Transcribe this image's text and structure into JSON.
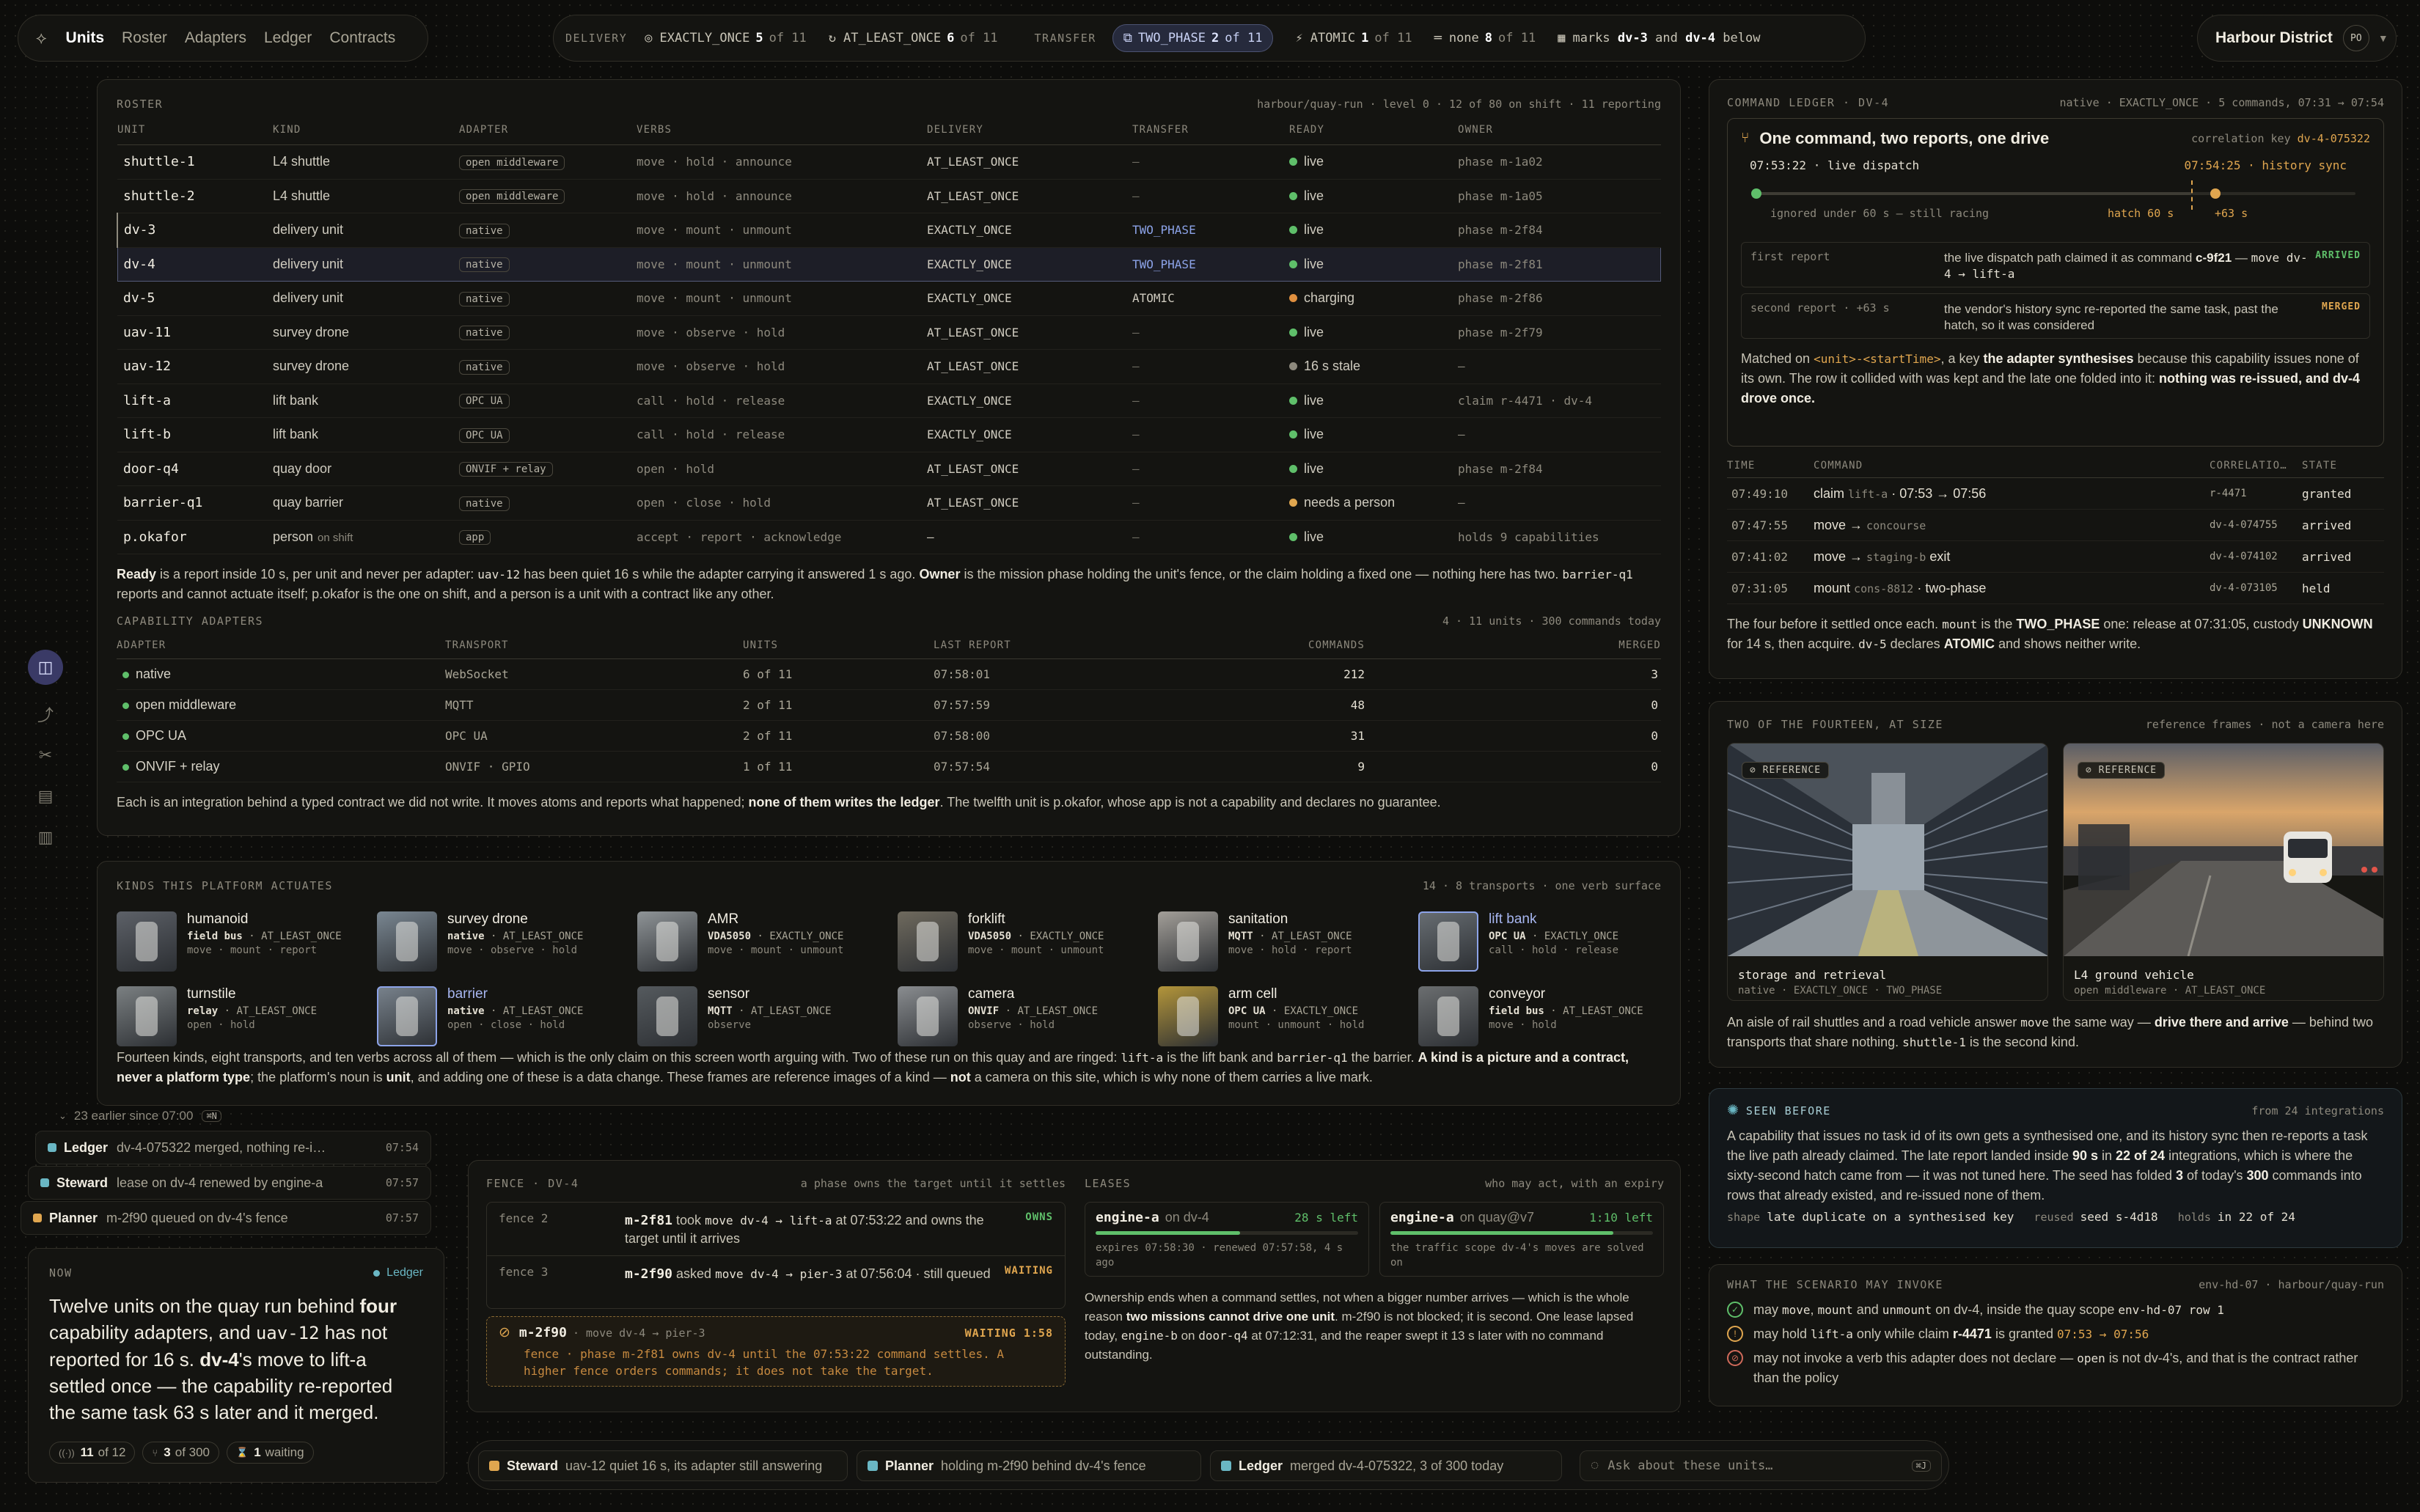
{
  "nav": {
    "items": [
      "Units",
      "Roster",
      "Adapters",
      "Ledger",
      "Contracts"
    ]
  },
  "status": {
    "delivery_label": "DELIVERY",
    "exactly_once": {
      "label": "EXACTLY_ONCE",
      "n": "5",
      "of": "of 11"
    },
    "at_least_once": {
      "label": "AT_LEAST_ONCE",
      "n": "6",
      "of": "of 11"
    },
    "transfer_label": "TRANSFER",
    "two_phase": {
      "label": "TWO_PHASE",
      "n": "2",
      "of": "of 11"
    },
    "atomic": {
      "label": "ATOMIC",
      "n": "1",
      "of": "of 11"
    },
    "none": {
      "label": "none",
      "n": "8",
      "of": "of 11"
    },
    "marks": {
      "pre": "marks",
      "a": "dv-3",
      "mid": "and",
      "b": "dv-4",
      "post": "below"
    }
  },
  "site": {
    "name": "Harbour District",
    "initials": "PO"
  },
  "roster": {
    "caption": "ROSTER",
    "meta": "harbour/quay-run · level 0 · 12 of 80 on shift · 11 reporting",
    "columns": [
      "UNIT",
      "KIND",
      "ADAPTER",
      "VERBS",
      "DELIVERY",
      "TRANSFER",
      "READY",
      "OWNER"
    ],
    "rows": [
      {
        "unit": "shuttle-1",
        "kind": "L4 shuttle",
        "adapter": "open middleware",
        "verbs": "move · hold · announce",
        "delivery": "AT_LEAST_ONCE",
        "transfer": "–",
        "ready": "live",
        "ready_color": "#5fbf6a",
        "owner": "phase m-1a02"
      },
      {
        "unit": "shuttle-2",
        "kind": "L4 shuttle",
        "adapter": "open middleware",
        "verbs": "move · hold · announce",
        "delivery": "AT_LEAST_ONCE",
        "transfer": "–",
        "ready": "live",
        "ready_color": "#5fbf6a",
        "owner": "phase m-1a05"
      },
      {
        "unit": "dv-3",
        "kind": "delivery unit",
        "adapter": "native",
        "verbs": "move · mount · unmount",
        "delivery": "EXACTLY_ONCE",
        "transfer": "TWO_PHASE",
        "ready": "live",
        "ready_color": "#5fbf6a",
        "owner": "phase m-2f84"
      },
      {
        "unit": "dv-4",
        "kind": "delivery unit",
        "adapter": "native",
        "verbs": "move · mount · unmount",
        "delivery": "EXACTLY_ONCE",
        "transfer": "TWO_PHASE",
        "ready": "live",
        "ready_color": "#5fbf6a",
        "owner": "phase m-2f81"
      },
      {
        "unit": "dv-5",
        "kind": "delivery unit",
        "adapter": "native",
        "verbs": "move · mount · unmount",
        "delivery": "EXACTLY_ONCE",
        "transfer": "ATOMIC",
        "ready": "charging",
        "ready_color": "#e0903f",
        "owner": "phase m-2f86"
      },
      {
        "unit": "uav-11",
        "kind": "survey drone",
        "adapter": "native",
        "verbs": "move · observe · hold",
        "delivery": "AT_LEAST_ONCE",
        "transfer": "–",
        "ready": "live",
        "ready_color": "#5fbf6a",
        "owner": "phase m-2f79"
      },
      {
        "unit": "uav-12",
        "kind": "survey drone",
        "adapter": "native",
        "verbs": "move · observe · hold",
        "delivery": "AT_LEAST_ONCE",
        "transfer": "–",
        "ready": "16 s stale",
        "ready_color": "#8d897d",
        "owner": "–"
      },
      {
        "unit": "lift-a",
        "kind": "lift bank",
        "adapter": "OPC UA",
        "verbs": "call · hold · release",
        "delivery": "EXACTLY_ONCE",
        "transfer": "–",
        "ready": "live",
        "ready_color": "#5fbf6a",
        "owner": "claim r-4471 · dv-4"
      },
      {
        "unit": "lift-b",
        "kind": "lift bank",
        "adapter": "OPC UA",
        "verbs": "call · hold · release",
        "delivery": "EXACTLY_ONCE",
        "transfer": "–",
        "ready": "live",
        "ready_color": "#5fbf6a",
        "owner": "–"
      },
      {
        "unit": "door-q4",
        "kind": "quay door",
        "adapter": "ONVIF + relay",
        "verbs": "open · hold",
        "delivery": "AT_LEAST_ONCE",
        "transfer": "–",
        "ready": "live",
        "ready_color": "#5fbf6a",
        "owner": "phase m-2f84"
      },
      {
        "unit": "barrier-q1",
        "kind": "quay barrier",
        "adapter": "native",
        "verbs": "open · close · hold",
        "delivery": "AT_LEAST_ONCE",
        "transfer": "–",
        "ready": "needs a person",
        "ready_color": "#e0a64f",
        "owner": "–"
      },
      {
        "unit": "p.okafor",
        "kind": "person",
        "kind_suffix": "on shift",
        "adapter": "app",
        "verbs": "accept · report · acknowledge",
        "delivery": "—",
        "transfer": "–",
        "ready": "live",
        "ready_color": "#5fbf6a",
        "owner": "holds 9 capabilities"
      }
    ],
    "note_html": "<b>Ready</b> is a report inside 10 s, per unit and never per adapter: <code>uav-12</code> has been quiet 16 s while the adapter carrying it answered 1 s ago. <b>Owner</b> is the mission phase holding the unit's fence, or the claim holding a fixed one — nothing here has two. <code>barrier-q1</code> reports and cannot actuate itself; p.okafor is the one on shift, and a person is a unit with a contract like any other."
  },
  "adapters": {
    "caption": "CAPABILITY ADAPTERS",
    "meta": "4 · 11 units · 300 commands today",
    "columns": [
      "ADAPTER",
      "TRANSPORT",
      "UNITS",
      "LAST REPORT",
      "COMMANDS",
      "MERGED"
    ],
    "rows": [
      {
        "name": "native",
        "transport": "WebSocket",
        "units": "6 of 11",
        "last": "07:58:01",
        "commands": "212",
        "merged": "3"
      },
      {
        "name": "open middleware",
        "transport": "MQTT",
        "units": "2 of 11",
        "last": "07:57:59",
        "commands": "48",
        "merged": "0"
      },
      {
        "name": "OPC UA",
        "transport": "OPC UA",
        "units": "2 of 11",
        "last": "07:58:00",
        "commands": "31",
        "merged": "0"
      },
      {
        "name": "ONVIF + relay",
        "transport": "ONVIF · GPIO",
        "units": "1 of 11",
        "last": "07:57:54",
        "commands": "9",
        "merged": "0"
      }
    ],
    "note_html": "Each is an integration behind a typed contract we did not write. It moves atoms and reports what happened; <b>none of them writes the ledger</b>. The twelfth unit is p.okafor, whose app is not a capability and declares no guarantee."
  },
  "kinds": {
    "caption": "KINDS THIS PLATFORM ACTUATES",
    "meta": "14 · 8 transports · one verb surface",
    "items": [
      {
        "name": "humanoid",
        "transport": "field bus",
        "delivery": "AT_LEAST_ONCE",
        "verbs": "move · mount · report"
      },
      {
        "name": "survey drone",
        "transport": "native",
        "delivery": "AT_LEAST_ONCE",
        "verbs": "move · observe · hold"
      },
      {
        "name": "AMR",
        "transport": "VDA5050",
        "delivery": "EXACTLY_ONCE",
        "verbs": "move · mount · unmount"
      },
      {
        "name": "forklift",
        "transport": "VDA5050",
        "delivery": "EXACTLY_ONCE",
        "verbs": "move · mount · unmount"
      },
      {
        "name": "sanitation",
        "transport": "MQTT",
        "delivery": "AT_LEAST_ONCE",
        "verbs": "move · hold · report"
      },
      {
        "name": "lift bank",
        "transport": "OPC UA",
        "delivery": "EXACTLY_ONCE",
        "verbs": "call · hold · release",
        "ringed": true
      },
      {
        "name": "turnstile",
        "transport": "relay",
        "delivery": "AT_LEAST_ONCE",
        "verbs": "open · hold"
      },
      {
        "name": "barrier",
        "transport": "native",
        "delivery": "AT_LEAST_ONCE",
        "verbs": "open · close · hold",
        "ringed": true
      },
      {
        "name": "sensor",
        "transport": "MQTT",
        "delivery": "AT_LEAST_ONCE",
        "verbs": "observe"
      },
      {
        "name": "camera",
        "transport": "ONVIF",
        "delivery": "AT_LEAST_ONCE",
        "verbs": "observe · hold"
      },
      {
        "name": "arm cell",
        "transport": "OPC UA",
        "delivery": "EXACTLY_ONCE",
        "verbs": "mount · unmount · hold"
      },
      {
        "name": "conveyor",
        "transport": "field bus",
        "delivery": "AT_LEAST_ONCE",
        "verbs": "move · hold"
      }
    ],
    "note_html": "Fourteen kinds, eight transports, and ten verbs across all of them — which is the only claim on this screen worth arguing with. Two of these run on this quay and are ringed: <code>lift-a</code> is the lift bank and <code>barrier-q1</code> the barrier. <b>A kind is a picture and a contract, never a platform type</b>; the platform's noun is <b>unit</b>, and adding one of these is a data change. These frames are reference images of a kind — <b>not</b> a camera on this site, which is why none of them carries a live mark."
  },
  "activity": {
    "earlier": "23 earlier since 07:00",
    "earlier_key": "⌘N",
    "items": [
      {
        "who": "Ledger",
        "text": "dv-4-075322 merged, nothing re-i…",
        "time": "07:54",
        "color": "#6ab7c4"
      },
      {
        "who": "Steward",
        "text": "lease on dv-4 renewed by engine-a",
        "time": "07:57",
        "color": "#6ab7c4"
      },
      {
        "who": "Planner",
        "text": "m-2f90 queued on dv-4's fence",
        "time": "07:57",
        "color": "#e0a64f"
      }
    ]
  },
  "now": {
    "caption": "NOW",
    "source": "Ledger",
    "text_html": "Twelve units on the quay run behind <b>four</b> capability adapters, and <span class='mono' style='font-size:24px'>uav-12</span> has not reported for 16 s. <b>dv-4</b>'s move to lift-a settled once — the capability re-reported the same task 63 s later and it merged.",
    "stats": [
      {
        "icon": "((·))",
        "n": "11",
        "label": "of 12"
      },
      {
        "icon": "⑂",
        "n": "3",
        "label": "of 300"
      },
      {
        "icon": "⌛",
        "n": "1",
        "label": "waiting"
      }
    ]
  },
  "fence": {
    "caption": "FENCE · DV-4",
    "meta": "a phase owns the target until it settles",
    "rows": [
      {
        "label": "fence 2",
        "who": "m-2f81",
        "text_html": "took <code>move dv-4 → lift-a</code> at 07:53:22 and owns the target until it arrives",
        "state": "OWNS",
        "state_color": "#5fbf6a"
      },
      {
        "label": "fence 3",
        "who": "m-2f90",
        "text_html": "asked <code>move dv-4 → pier-3</code> at 07:56:04 · still queued",
        "state": "WAITING",
        "state_color": "#e0a64f"
      }
    ],
    "wait": {
      "who": "m-2f90",
      "cmd": "· move dv-4 → pier-3",
      "state": "WAITING 1:58",
      "text": "fence · phase m-2f81 owns dv-4 until the 07:53:22 command settles. A higher fence orders commands; it does not take the target."
    }
  },
  "leases": {
    "caption": "LEASES",
    "meta": "who may act, with an expiry",
    "items": [
      {
        "holder": "engine-a",
        "on": "on dv-4",
        "left": "28 s left",
        "fill": 0.55,
        "sub": "expires 07:58:30 · renewed 07:57:58, 4 s ago"
      },
      {
        "holder": "engine-a",
        "on": "on quay@v7",
        "left": "1:10 left",
        "fill": 0.85,
        "sub": "the traffic scope dv-4's moves are solved on"
      }
    ],
    "note_html": "Ownership ends when a command settles, not when a bigger number arrives — which is the whole reason <b>two missions cannot drive one unit</b>. m-2f90 is not blocked; it is second. One lease lapsed today, <code>engine-b</code> on <code>door-q4</code> at 07:12:31, and the reaper swept it 13 s later with no command outstanding."
  },
  "bottom": {
    "chips": [
      {
        "who": "Steward",
        "text": "uav-12 quiet 16 s, its adapter still answering",
        "color": "#e0a64f"
      },
      {
        "who": "Planner",
        "text": "holding m-2f90 behind dv-4's fence",
        "color": "#6ab7c4"
      },
      {
        "who": "Ledger",
        "text": "merged dv-4-075322, 3 of 300 today",
        "color": "#6ab7c4"
      }
    ],
    "ask_placeholder": "Ask about these units…",
    "ask_key": "⌘J"
  },
  "ledger": {
    "caption": "COMMAND LEDGER · DV-4",
    "meta": "native · EXACTLY_ONCE · 5 commands, 07:31 → 07:54",
    "title": "One command, two reports, one drive",
    "corr_label": "correlation key",
    "corr_key": "dv-4-075322",
    "t_live": "07:53:22 · live dispatch",
    "t_sync": "07:54:25 · history sync",
    "ignored": "ignored under 60 s — still racing",
    "hatch": "hatch 60 s",
    "plus": "+63 s",
    "reports": [
      {
        "label": "first report",
        "text_html": "the live dispatch path claimed it as command <b>c-9f21</b> — <code>move dv-4 → lift-a</code>",
        "state": "ARRIVED",
        "color": "#5fbf6a"
      },
      {
        "label": "second report · +63 s",
        "text_html": "the vendor's history sync re-reported the same task, past the hatch, so it was considered",
        "state": "MERGED",
        "color": "#e0a64f"
      }
    ],
    "matched_html": "Matched on <span class='mono amber' style='font-size:16px'>&lt;unit&gt;-&lt;startTime&gt;</span>, a key <b>the adapter synthesises</b> because this capability issues none of its own. The row it collided with was kept and the late one folded into it: <b>nothing was re-issued, and dv-4 drove once.</b>",
    "columns": [
      "TIME",
      "COMMAND",
      "CORRELATIO…",
      "STATE"
    ],
    "rows": [
      {
        "time": "07:49:10",
        "cmd": "claim",
        "cmd_mono": "lift-a",
        "cmd_rest": "· 07:53 → 07:56",
        "corr": "r-4471",
        "state": "granted"
      },
      {
        "time": "07:47:55",
        "cmd": "move →",
        "cmd_mono": "concourse",
        "cmd_rest": "",
        "corr": "dv-4-074755",
        "state": "arrived"
      },
      {
        "time": "07:41:02",
        "cmd": "move →",
        "cmd_mono": "staging-b",
        "cmd_rest": "exit",
        "corr": "dv-4-074102",
        "state": "arrived"
      },
      {
        "time": "07:31:05",
        "cmd": "mount",
        "cmd_mono": "cons-8812",
        "cmd_rest": "· two-phase",
        "corr": "dv-4-073105",
        "state": "held"
      }
    ],
    "note_html": "The four before it settled once each. <code>mount</code> is the <b>TWO_PHASE</b> one: release at 07:31:05, custody <b>UNKNOWN</b> for 14 s, then acquire. <code>dv-5</code> declares <b>ATOMIC</b> and shows neither write."
  },
  "frames": {
    "caption": "TWO OF THE FOURTEEN, AT SIZE",
    "meta": "reference frames · not a camera here",
    "tag": "REFERENCE",
    "items": [
      {
        "name": "storage and retrieval",
        "sub": "native · EXACTLY_ONCE · TWO_PHASE"
      },
      {
        "name": "L4 ground vehicle",
        "sub": "open middleware · AT_LEAST_ONCE"
      }
    ],
    "note_html": "An aisle of rail shuttles and a road vehicle answer <code>move</code> the same way — <b>drive there and arrive</b> — behind two transports that share nothing. <code>shuttle-1</code> is the second kind."
  },
  "seen": {
    "caption": "SEEN BEFORE",
    "meta": "from 24 integrations",
    "text_html": "A capability that issues no task id of its own gets a synthesised one, and its history sync then re-reports a task the live path already claimed. The late report landed inside <b>90 s</b> in <b>22 of 24</b> integrations, which is where the sixty-second hatch came from — it was not tuned here. The seed has folded <b>3</b> of today's <b>300</b> commands into rows that already existed, and re-issued none of them.",
    "footer_html": "shape <code>late duplicate on a synthesised key</code> &nbsp; reused <code>seed s-4d18</code> &nbsp; holds <code>in 22 of 24</code>"
  },
  "invoke": {
    "caption": "WHAT THE SCENARIO MAY INVOKE",
    "meta": "env-hd-07 · harbour/quay-run",
    "items": [
      {
        "icon": "✓",
        "color": "#5fbf6a",
        "text_html": "may <code>move</code>, <code>mount</code> and <code>unmount</code> on dv-4, inside the quay scope <code>env-hd-07 row 1</code>"
      },
      {
        "icon": "!",
        "color": "#e0a64f",
        "text_html": "may hold <code>lift-a</code> only while claim <b>r-4471</b> is granted <span class='mono amber' style='font-size:16px'>07:53 → 07:56</span>"
      },
      {
        "icon": "⊘",
        "color": "#d06a5a",
        "text_html": "may not invoke a verb this adapter does not declare — <code>open</code> is not dv-4's, and that is the contract rather than the policy"
      }
    ]
  }
}
